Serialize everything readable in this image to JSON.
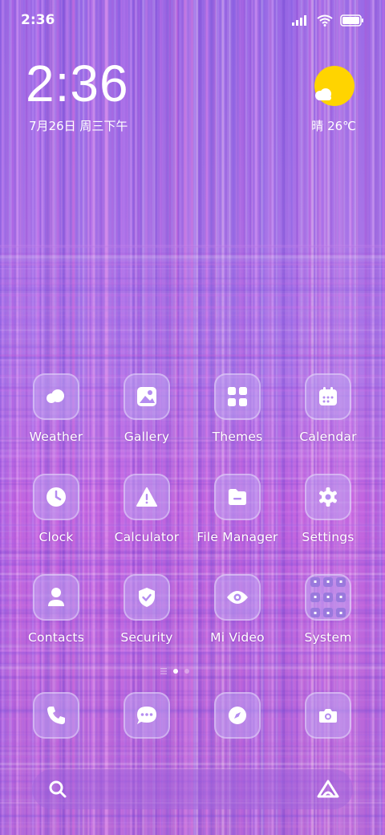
{
  "status_bar": {
    "time": "2:36",
    "icons": [
      "signal-icon",
      "wifi-icon",
      "battery-icon"
    ]
  },
  "clock_widget": {
    "time": "2:36",
    "date": "7月26日 周三下午"
  },
  "weather_widget": {
    "text": "晴 26℃",
    "icon": "sun-cloud-icon"
  },
  "apps": [
    {
      "label": "Weather",
      "icon": "weather-icon"
    },
    {
      "label": "Gallery",
      "icon": "gallery-icon"
    },
    {
      "label": "Themes",
      "icon": "themes-icon"
    },
    {
      "label": "Calendar",
      "icon": "calendar-icon"
    },
    {
      "label": "Clock",
      "icon": "clock-icon"
    },
    {
      "label": "Calculator",
      "icon": "calculator-icon"
    },
    {
      "label": "File Manager",
      "icon": "file-manager-icon"
    },
    {
      "label": "Settings",
      "icon": "settings-icon"
    },
    {
      "label": "Contacts",
      "icon": "contacts-icon"
    },
    {
      "label": "Security",
      "icon": "security-icon"
    },
    {
      "label": "Mi Video",
      "icon": "mi-video-icon"
    },
    {
      "label": "System",
      "icon": "folder-icon"
    }
  ],
  "page_indicator": {
    "pages": 2,
    "current": 1
  },
  "dock": [
    "phone-icon",
    "messages-icon",
    "browser-icon",
    "camera-icon"
  ],
  "search_bar": {
    "left_icon": "search-icon",
    "right_icon": "assistant-icon"
  },
  "colors": {
    "accent": "#b48cf0",
    "sun": "#ffd400"
  }
}
